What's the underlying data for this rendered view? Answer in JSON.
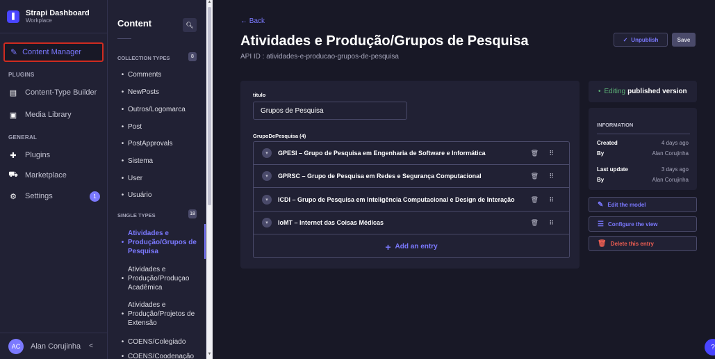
{
  "brand": {
    "title": "Strapi Dashboard",
    "subtitle": "Workplace",
    "logo_icon": "strapi-logo"
  },
  "mainnav": {
    "content_manager": "Content Manager",
    "plugins_section": "PLUGINS",
    "plugins_items": [
      "Content-Type Builder",
      "Media Library"
    ],
    "general_section": "GENERAL",
    "general_items": [
      "Plugins",
      "Marketplace",
      "Settings"
    ],
    "settings_badge": "1",
    "user": {
      "initials": "AC",
      "name": "Alan Corujinha",
      "collapse": "<"
    }
  },
  "subnav": {
    "title": "Content",
    "collection_section": "COLLECTION TYPES",
    "collection_count": "8",
    "collection_items": [
      "Comments",
      "NewPosts",
      "Outros/Logomarca",
      "Post",
      "PostApprovals",
      "Sistema",
      "User",
      "Usuário"
    ],
    "single_section": "SINGLE TYPES",
    "single_count": "18",
    "single_items": [
      "Atividades e Produção/Grupos de Pesquisa",
      "Atividades e Produção/Produçao Acadêmica",
      "Atividades e Produção/Projetos de Extensão",
      "COENS/Colegiado",
      "COENS/Coodenação"
    ]
  },
  "header": {
    "back": "Back",
    "title": "Atividades e Produção/Grupos de Pesquisa",
    "api_id": "API ID : atividades-e-producao-grupos-de-pesquisa",
    "unpublish": "Unpublish",
    "save": "Save"
  },
  "form": {
    "titulo_label": "titulo",
    "titulo_value": "Grupos de Pesquisa",
    "grupo_label": "GrupoDePesquisa (4)",
    "entries": [
      "GPESI – Grupo de Pesquisa em Engenharia de Software e Informática",
      "GPRSC – Grupo de Pesquisa em Redes e Segurança Computacional",
      "ICDI – Grupo de Pesquisa em Inteligência Computacional e Design de Interação",
      "IoMT – Internet das Coisas Médicas"
    ],
    "add_entry": "Add an entry"
  },
  "aside": {
    "status_prefix": "Editing",
    "status_bold": "published version",
    "info_title": "INFORMATION",
    "created_label": "Created",
    "created_value": "4 days ago",
    "by_label": "By",
    "created_by": "Alan Corujinha",
    "updated_label": "Last update",
    "updated_value": "3 days ago",
    "updated_by": "Alan Corujinha",
    "edit_model": "Edit the model",
    "configure_view": "Configure the view",
    "delete_entry": "Delete this entry"
  },
  "help": "?",
  "colors": {
    "accent": "#7b79ff",
    "danger": "#ee5e52",
    "success": "#5cb176",
    "highlight_border": "#d02b20"
  }
}
